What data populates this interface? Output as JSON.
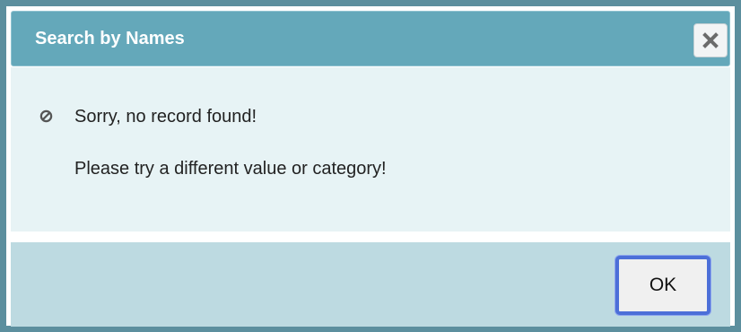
{
  "dialog": {
    "title": "Search by Names",
    "close_icon": "close-x-icon",
    "message_icon": "no-entry-icon",
    "message_primary": "Sorry, no record found!",
    "message_secondary": "Please try a different value or category!",
    "ok_label": "OK"
  },
  "colors": {
    "titlebar": "#64a8ba",
    "content_bg": "#e7f3f5",
    "footer_bg": "#bddae1",
    "ok_focus_border": "#4c6fd8",
    "frame": "#5c8f9e"
  }
}
